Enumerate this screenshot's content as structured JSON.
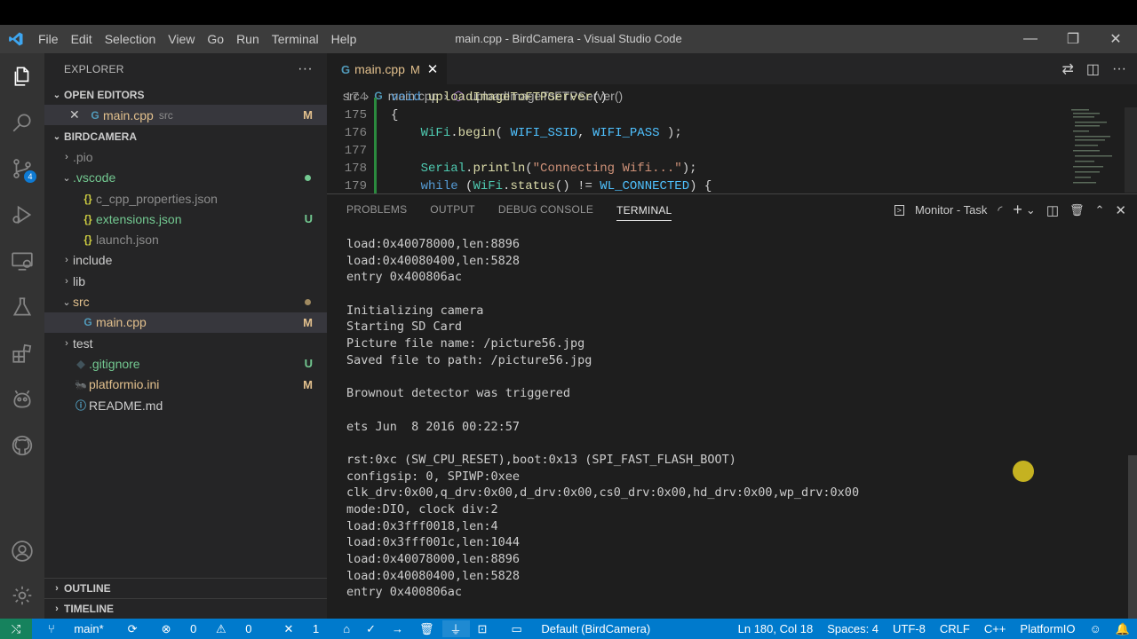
{
  "window": {
    "title": "main.cpp - BirdCamera - Visual Studio Code",
    "menu": [
      "File",
      "Edit",
      "Selection",
      "View",
      "Go",
      "Run",
      "Terminal",
      "Help"
    ]
  },
  "activity_bar": {
    "scm_badge": "4"
  },
  "sidebar": {
    "title": "EXPLORER",
    "more": "···",
    "open_editors": {
      "header": "OPEN EDITORS",
      "items": [
        {
          "name": "main.cpp",
          "path": "src",
          "flag": "M"
        }
      ]
    },
    "project": {
      "header": "BIRDCAMERA",
      "items": [
        {
          "arrow": "›",
          "icon": "",
          "label": ".pio",
          "flag": ""
        },
        {
          "arrow": "⌄",
          "icon": "",
          "label": ".vscode",
          "flag": "dot-green"
        },
        {
          "arrow": "",
          "icon": "{}",
          "label": "c_cpp_properties.json",
          "flag": ""
        },
        {
          "arrow": "",
          "icon": "{}",
          "label": "extensions.json",
          "flag": "U"
        },
        {
          "arrow": "",
          "icon": "{}",
          "label": "launch.json",
          "flag": ""
        },
        {
          "arrow": "›",
          "icon": "",
          "label": "include",
          "flag": ""
        },
        {
          "arrow": "›",
          "icon": "",
          "label": "lib",
          "flag": ""
        },
        {
          "arrow": "⌄",
          "icon": "",
          "label": "src",
          "flag": "dot-brown"
        },
        {
          "arrow": "",
          "icon": "G",
          "label": "main.cpp",
          "flag": "M"
        },
        {
          "arrow": "›",
          "icon": "",
          "label": "test",
          "flag": ""
        },
        {
          "arrow": "",
          "icon": "◆",
          "label": ".gitignore",
          "flag": "U"
        },
        {
          "arrow": "",
          "icon": "🐜",
          "label": "platformio.ini",
          "flag": "M"
        },
        {
          "arrow": "",
          "icon": "ⓘ",
          "label": "README.md",
          "flag": ""
        }
      ]
    },
    "outline": "OUTLINE",
    "timeline": "TIMELINE"
  },
  "editor": {
    "tab": {
      "label": "main.cpp",
      "flag": "M"
    },
    "breadcrumbs": [
      "src",
      "main.cpp",
      "uploadImageToFTPServer()"
    ],
    "lines": [
      {
        "no": "174",
        "text": "void uploadImageToFTPServer()"
      },
      {
        "no": "175",
        "text": "{"
      },
      {
        "no": "176",
        "text": "    WiFi.begin( WIFI_SSID, WIFI_PASS );"
      },
      {
        "no": "177",
        "text": ""
      },
      {
        "no": "178",
        "text": "    Serial.println(\"Connecting Wifi...\");"
      },
      {
        "no": "179",
        "text": "    while (WiFi.status() != WL_CONNECTED) {"
      }
    ]
  },
  "panel": {
    "tabs": [
      "PROBLEMS",
      "OUTPUT",
      "DEBUG CONSOLE",
      "TERMINAL"
    ],
    "active_tab": "TERMINAL",
    "task_label": "Monitor - Task",
    "terminal_lines": [
      "load:0x40078000,len:8896",
      "load:0x40080400,len:5828",
      "entry 0x400806ac",
      "",
      "Initializing camera",
      "Starting SD Card",
      "Picture file name: /picture56.jpg",
      "Saved file to path: /picture56.jpg",
      "",
      "Brownout detector was triggered",
      "",
      "ets Jun  8 2016 00:22:57",
      "",
      "rst:0xc (SW_CPU_RESET),boot:0x13 (SPI_FAST_FLASH_BOOT)",
      "configsip: 0, SPIWP:0xee",
      "clk_drv:0x00,q_drv:0x00,d_drv:0x00,cs0_drv:0x00,hd_drv:0x00,wp_drv:0x00",
      "mode:DIO, clock div:2",
      "load:0x3fff0018,len:4",
      "load:0x3fff001c,len:1044",
      "load:0x40078000,len:8896",
      "load:0x40080400,len:5828",
      "entry 0x400806ac"
    ]
  },
  "status_bar": {
    "branch": "main*",
    "errors": "0",
    "warnings": "0",
    "tasks": "1",
    "env": "Default (BirdCamera)",
    "position": "Ln 180, Col 18",
    "spaces": "Spaces: 4",
    "encoding": "UTF-8",
    "eol": "CRLF",
    "language": "C++",
    "platform": "PlatformIO"
  }
}
